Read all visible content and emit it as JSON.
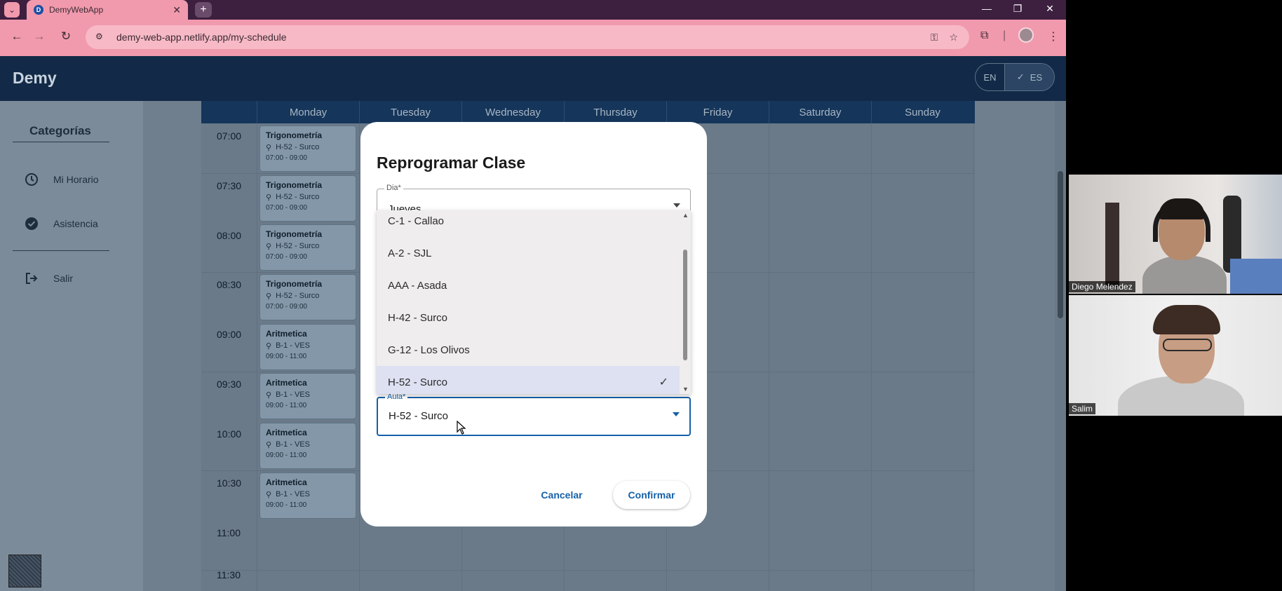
{
  "browser": {
    "tab_title": "DemyWebApp",
    "tab_favicon_letter": "D",
    "url": "demy-web-app.netlify.app/my-schedule",
    "window_controls": [
      "—",
      "❐",
      "✕"
    ]
  },
  "app": {
    "logo": "Demy",
    "lang": {
      "en": "EN",
      "es": "ES",
      "selected": "ES"
    }
  },
  "sidebar": {
    "title": "Categorías",
    "items": [
      {
        "label": "Mi Horario",
        "icon": "clock-icon"
      },
      {
        "label": "Asistencia",
        "icon": "check-circle-icon"
      },
      {
        "label": "Salir",
        "icon": "logout-icon"
      }
    ]
  },
  "schedule": {
    "days": [
      "Monday",
      "Tuesday",
      "Wednesday",
      "Thursday",
      "Friday",
      "Saturday",
      "Sunday"
    ],
    "times": [
      "07:00",
      "07:30",
      "08:00",
      "08:30",
      "09:00",
      "09:30",
      "10:00",
      "10:30",
      "11:00",
      "11:30"
    ],
    "classes": [
      {
        "name": "Trigonometría",
        "location": "H-52 - Surco",
        "time": "07:00 - 09:00"
      },
      {
        "name": "Trigonometría",
        "location": "H-52 - Surco",
        "time": "07:00 - 09:00"
      },
      {
        "name": "Trigonometría",
        "location": "H-52 - Surco",
        "time": "07:00 - 09:00"
      },
      {
        "name": "Trigonometría",
        "location": "H-52 - Surco",
        "time": "07:00 - 09:00"
      },
      {
        "name": "Aritmetica",
        "location": "B-1 - VES",
        "time": "09:00 - 11:00"
      },
      {
        "name": "Aritmetica",
        "location": "B-1 - VES",
        "time": "09:00 - 11:00"
      },
      {
        "name": "Aritmetica",
        "location": "B-1 - VES",
        "time": "09:00 - 11:00"
      },
      {
        "name": "Aritmetica",
        "location": "B-1 - VES",
        "time": "09:00 - 11:00"
      }
    ]
  },
  "dialog": {
    "title": "Reprogramar Clase",
    "day_field": {
      "label": "Dia*",
      "value": "Jueves"
    },
    "aula_field": {
      "label": "Aula*",
      "value": "H-52 - Surco"
    },
    "options": [
      "C-1 - Callao",
      "A-2 - SJL",
      "AAA - Asada",
      "H-42 - Surco",
      "G-12 - Los Olivos",
      "H-52 - Surco"
    ],
    "selected_option": "H-52 - Surco",
    "cancel_label": "Cancelar",
    "confirm_label": "Confirmar",
    "accent_color": "#1560a8"
  },
  "video_call": {
    "participants": [
      {
        "name": "Diego Melendez"
      },
      {
        "name": "Salim"
      }
    ]
  }
}
